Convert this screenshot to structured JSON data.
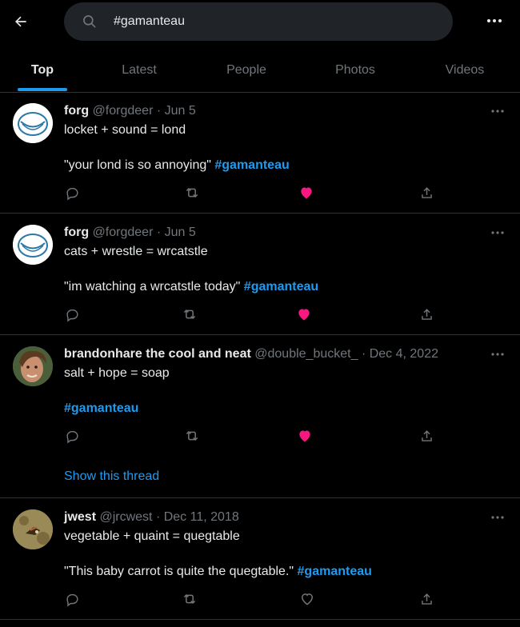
{
  "search": {
    "query": "#gamanteau"
  },
  "tabs": [
    {
      "label": "Top"
    },
    {
      "label": "Latest"
    },
    {
      "label": "People"
    },
    {
      "label": "Photos"
    },
    {
      "label": "Videos"
    }
  ],
  "tweets": [
    {
      "name": "forg",
      "handle": "@forgdeer",
      "date": "Jun 5",
      "line1": "locket + sound = lond",
      "line2_text": "\"your lond is so annoying\"",
      "hashtag": "#gamanteau",
      "liked": true
    },
    {
      "name": "forg",
      "handle": "@forgdeer",
      "date": "Jun 5",
      "line1": "cats + wrestle = wrcatstle",
      "line2_text": "\"im watching a wrcatstle today\"",
      "hashtag": "#gamanteau",
      "liked": true
    },
    {
      "name": "brandonhare the cool and neat",
      "handle": "@double_bucket_",
      "date": "Dec 4, 2022",
      "line1": "salt + hope = soap",
      "line2_text": "",
      "hashtag": "#gamanteau",
      "liked": true,
      "show_thread": "Show this thread"
    },
    {
      "name": "jwest",
      "handle": "@jrcwest",
      "date": "Dec 11, 2018",
      "line1": "vegetable + quaint = quegtable",
      "line2_text": "\"This baby carrot is quite the quegtable.\"",
      "hashtag": "#gamanteau",
      "liked": false
    }
  ],
  "colors": {
    "accent": "#1d9bf0",
    "like": "#f91880",
    "muted": "#71767b",
    "border": "#2f3336"
  },
  "icons": [
    "back-arrow-icon",
    "search-icon",
    "more-icon",
    "reply-icon",
    "retweet-icon",
    "like-icon",
    "share-icon"
  ]
}
